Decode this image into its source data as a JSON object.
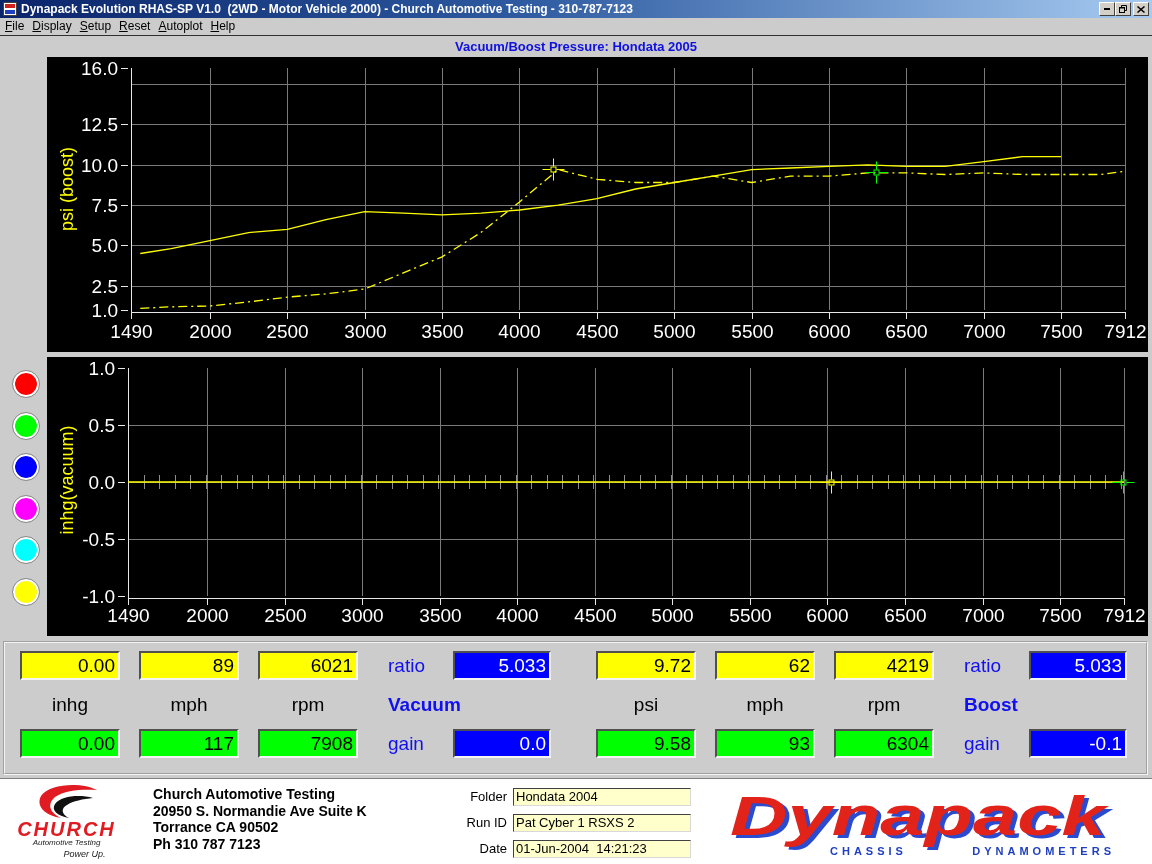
{
  "window": {
    "title": "Dynapack Evolution RHAS-SP V1.0  (2WD - Motor Vehicle 2000) - Church Automotive Testing - 310-787-7123"
  },
  "menu": [
    "File",
    "Display",
    "Setup",
    "Reset",
    "Autoplot",
    "Help"
  ],
  "chart_title": "Vacuum/Boost Pressure: Hondata 2005",
  "boost_chart": {
    "chart_data": {
      "type": "line",
      "ylabel": "psi (boost)",
      "x": [
        1550,
        1750,
        2000,
        2250,
        2500,
        2750,
        3000,
        3250,
        3500,
        3750,
        4000,
        4250,
        4500,
        4750,
        5000,
        5250,
        5500,
        5750,
        6000,
        6250,
        6500,
        6750,
        7000,
        7250,
        7500,
        7750,
        7912
      ],
      "series": [
        {
          "color": "#ffff00",
          "line_style": "solid",
          "values": [
            4.5,
            4.8,
            5.3,
            5.8,
            6.0,
            6.6,
            7.1,
            7.0,
            6.9,
            7.0,
            7.2,
            7.5,
            7.9,
            8.5,
            8.9,
            9.3,
            9.7,
            9.8,
            9.9,
            10.0,
            9.9,
            9.9,
            10.2,
            10.5,
            10.5,
            null,
            null
          ]
        },
        {
          "color": "#ffff00",
          "line_style": "dashdot",
          "values": [
            1.1,
            1.2,
            1.25,
            1.5,
            1.8,
            2.0,
            2.3,
            3.3,
            4.3,
            5.8,
            7.7,
            9.7,
            9.1,
            8.9,
            8.9,
            9.3,
            8.9,
            9.3,
            9.3,
            9.5,
            9.5,
            9.4,
            9.5,
            9.4,
            9.4,
            9.4,
            9.6
          ]
        }
      ],
      "xlim": [
        1490,
        7912
      ],
      "ylim": [
        1,
        16
      ],
      "xticks": [
        1490,
        2000,
        2500,
        3000,
        3500,
        4000,
        4500,
        5000,
        5500,
        6000,
        6500,
        7000,
        7500,
        7912
      ],
      "yticks": [
        {
          "value": 1,
          "label": "1.0"
        },
        2.5,
        {
          "value": 5,
          "label": "5.0"
        },
        7.5,
        {
          "value": 10,
          "label": "10.0"
        },
        12.5,
        {
          "value": 16,
          "label": "16.0"
        }
      ],
      "grid": true
    }
  },
  "color_buttons": [
    {
      "color": "#ff0000"
    },
    {
      "color": "#00ff00"
    },
    {
      "color": "#0000ff"
    },
    {
      "color": "#ff00ff"
    },
    {
      "color": "#00ffff"
    },
    {
      "color": "#ffff00"
    }
  ],
  "vacuum_chart": {
    "chart_data": {
      "type": "line",
      "ylabel": "inhg(vacuum)",
      "x": [
        1490,
        1590,
        1690,
        1790,
        1890,
        1990,
        2090,
        2190,
        2290,
        2390,
        2490,
        2590,
        2690,
        2790,
        2890,
        2990,
        3090,
        3190,
        3290,
        3390,
        3490,
        3590,
        3690,
        3790,
        3890,
        3990,
        4090,
        4190,
        4290,
        4390,
        4490,
        4590,
        4690,
        4790,
        4890,
        4990,
        5090,
        5190,
        5290,
        5390,
        5490,
        5590,
        5690,
        5790,
        5890,
        5990,
        6090,
        6190,
        6290,
        6390,
        6490,
        6590,
        6690,
        6790,
        6890,
        6990,
        7090,
        7190,
        7290,
        7390,
        7490,
        7590,
        7690,
        7790,
        7890,
        7912
      ],
      "series": [
        {
          "color": "#ffff00",
          "line_style": "solid",
          "values": [
            0,
            0,
            0,
            0,
            0,
            0,
            0,
            0,
            0,
            0,
            0,
            0,
            0,
            0,
            0,
            0,
            0,
            0,
            0,
            0,
            0,
            0,
            0,
            0,
            0,
            0,
            0,
            0,
            0,
            0,
            0,
            0,
            0,
            0,
            0,
            0,
            0,
            0,
            0,
            0,
            0,
            0,
            0,
            0,
            0,
            0,
            0,
            0,
            0,
            0,
            0,
            0,
            0,
            0,
            0,
            0,
            0,
            0,
            0,
            0,
            0,
            0,
            0,
            0,
            0,
            0
          ]
        }
      ],
      "xlim": [
        1490,
        7912
      ],
      "ylim": [
        -1,
        1
      ],
      "xticks": [
        1490,
        2000,
        2500,
        3000,
        3500,
        4000,
        4500,
        5000,
        5500,
        6000,
        6500,
        7000,
        7500,
        7912
      ],
      "yticks": [
        {
          "value": -1,
          "label": "-1.0"
        },
        -0.5,
        {
          "value": 0,
          "label": "0.0"
        },
        0.5,
        {
          "value": 1,
          "label": "1.0"
        }
      ],
      "grid": true
    }
  },
  "readouts": [
    {
      "title": "Vacuum",
      "units": [
        "inhg",
        "mph",
        "rpm"
      ],
      "rows": [
        {
          "color": "#ffff00",
          "values": [
            "0.00",
            "89",
            "6021"
          ],
          "setting_label": "ratio",
          "setting": "5.033"
        },
        {
          "color": "#00ff00",
          "values": [
            "0.00",
            "117",
            "7908"
          ],
          "setting_label": "gain",
          "setting": "0.0"
        }
      ]
    },
    {
      "title": "Boost",
      "units": [
        "psi",
        "mph",
        "rpm"
      ],
      "rows": [
        {
          "color": "#ffff00",
          "values": [
            "9.72",
            "62",
            "4219"
          ],
          "setting_label": "ratio",
          "setting": "5.033"
        },
        {
          "color": "#00ff00",
          "values": [
            "9.58",
            "93",
            "6304"
          ],
          "setting_label": "gain",
          "setting": "-0.1"
        }
      ]
    }
  ],
  "footer": {
    "church_logo": {
      "wordmark": "CHURCH",
      "tagline": "Automotive Testing",
      "slogan": "Power Up."
    },
    "address": [
      "Church Automotive Testing",
      "20950 S. Normandie Ave Suite K",
      "Torrance CA 90502",
      "Ph 310 787 7123"
    ],
    "fields": [
      {
        "label": "Folder",
        "value": "Hondata 2004"
      },
      {
        "label": "Run ID",
        "value": "Pat Cyber 1 RSXS 2"
      },
      {
        "label": "Date",
        "value": "01-Jun-2004  14:21:23"
      }
    ],
    "dynapack_logo": {
      "wordmark": "Dynapack",
      "subtitle": [
        "CHASSIS",
        "DYNAMOMETERS"
      ]
    }
  }
}
